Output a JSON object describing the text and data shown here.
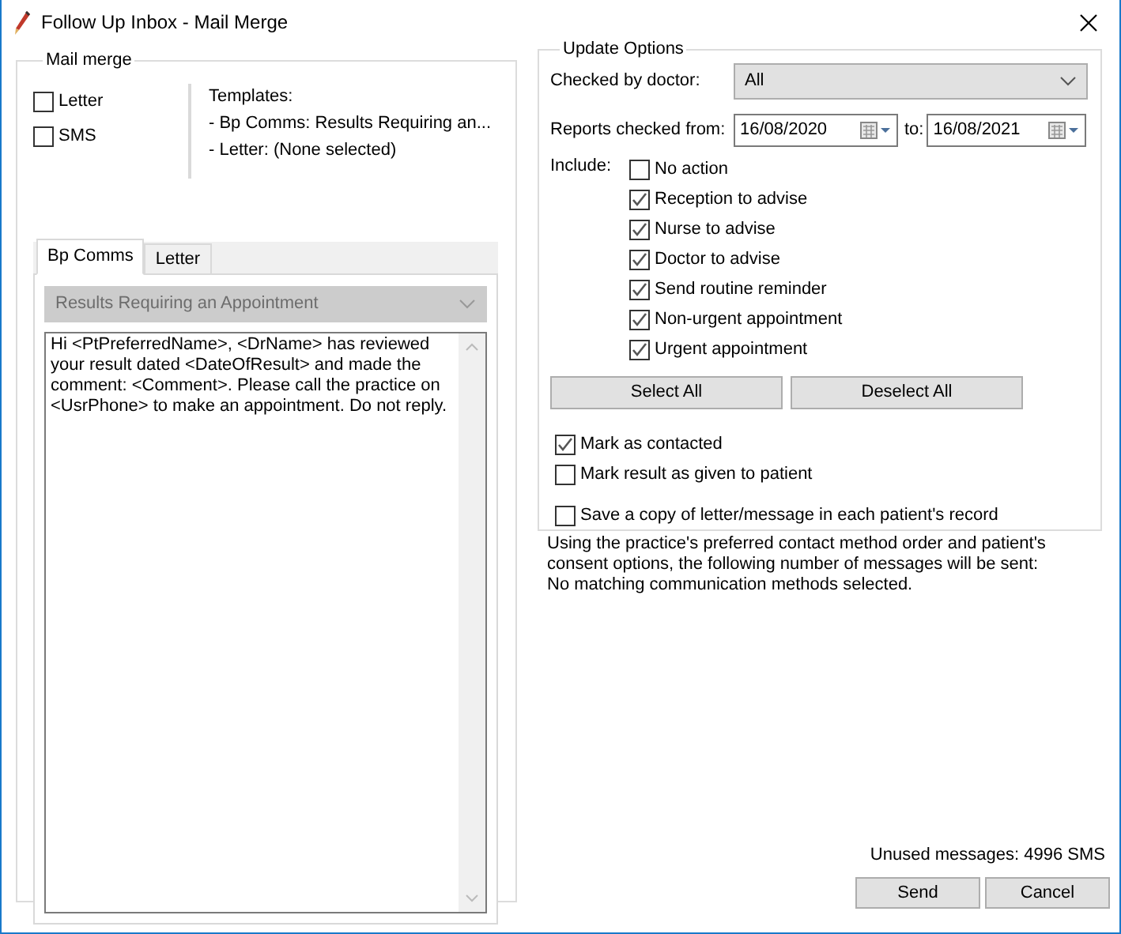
{
  "window": {
    "title": "Follow Up Inbox - Mail Merge"
  },
  "mail_merge": {
    "legend": "Mail merge",
    "channels": [
      {
        "label": "Letter",
        "checked": false
      },
      {
        "label": "SMS",
        "checked": false
      }
    ],
    "templates": {
      "heading": "Templates:",
      "lines": [
        "- Bp Comms: Results Requiring an...",
        "- Letter: (None selected)"
      ]
    },
    "tabs": [
      {
        "label": "Bp Comms",
        "selected": true
      },
      {
        "label": "Letter",
        "selected": false
      }
    ],
    "template_select": {
      "value": "Results Requiring an Appointment",
      "disabled": true
    },
    "message": "Hi <PtPreferredName>, <DrName> has reviewed your result dated <DateOfResult> and made the comment: <Comment>. Please call the practice on <UsrPhone> to make an appointment. Do not reply."
  },
  "update_options": {
    "legend": "Update Options",
    "checked_by_doctor": {
      "label": "Checked by doctor:",
      "value": "All"
    },
    "reports": {
      "label": "Reports checked from:",
      "from": "16/08/2020",
      "to_label": "to:",
      "to": "16/08/2021"
    },
    "include": {
      "label": "Include:",
      "options": [
        {
          "label": "No action",
          "checked": false
        },
        {
          "label": "Reception to advise",
          "checked": true
        },
        {
          "label": "Nurse to advise",
          "checked": true
        },
        {
          "label": "Doctor to advise",
          "checked": true
        },
        {
          "label": "Send routine reminder",
          "checked": true
        },
        {
          "label": "Non-urgent appointment",
          "checked": true
        },
        {
          "label": "Urgent appointment",
          "checked": true
        }
      ]
    },
    "buttons": [
      "Select All",
      "Deselect All"
    ],
    "marks": [
      {
        "label": "Mark as contacted",
        "checked": true
      },
      {
        "label": "Mark result as given to patient",
        "checked": false
      }
    ],
    "save_copy": {
      "label": "Save a copy of letter/message in each patient's record",
      "checked": false
    }
  },
  "summary": "Using the practice's preferred contact method order and patient's\nconsent options, the following number of messages will be sent:",
  "status": "No matching communication methods selected.",
  "unused": "Unused messages: 4996 SMS",
  "footer_buttons": [
    "Send",
    "Cancel"
  ]
}
